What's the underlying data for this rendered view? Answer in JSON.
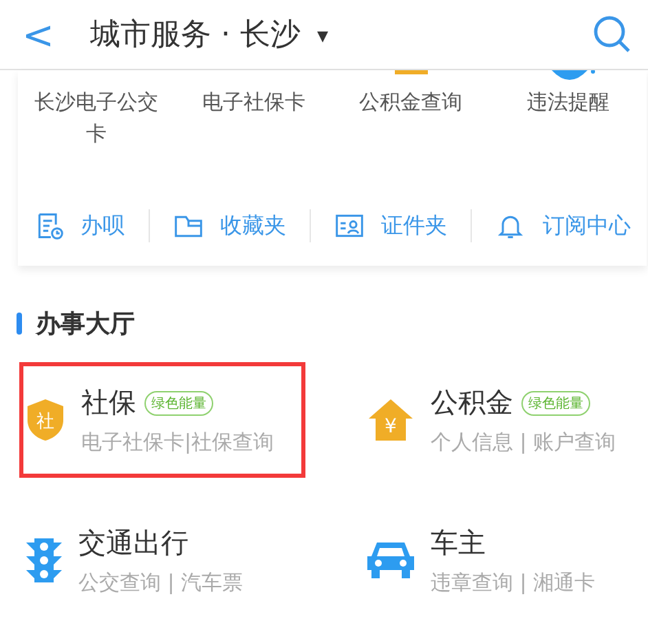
{
  "header": {
    "back": "<",
    "title": "城市服务 · 长沙",
    "dropdown": "▾"
  },
  "shortcuts": [
    {
      "label": "长沙电子公交卡"
    },
    {
      "label": "电子社保卡"
    },
    {
      "label": "公积金查询"
    },
    {
      "label": "违法提醒"
    }
  ],
  "links": [
    {
      "label": "办呗",
      "kind": "doc-clock"
    },
    {
      "label": "收藏夹",
      "kind": "folder"
    },
    {
      "label": "证件夹",
      "kind": "id-card"
    },
    {
      "label": "订阅中心",
      "kind": "bell"
    }
  ],
  "section": {
    "title": "办事大厅"
  },
  "services": [
    {
      "title": "社保",
      "badge": "绿色能量",
      "subtitle": "电子社保卡|社保查询",
      "kind": "shield",
      "icon_text": "社",
      "highlighted": true
    },
    {
      "title": "公积金",
      "badge": "绿色能量",
      "subtitle": "个人信息 | 账户查询",
      "kind": "house",
      "icon_text": "¥",
      "highlighted": false
    },
    {
      "title": "交通出行",
      "subtitle": "公交查询 | 汽车票",
      "kind": "traffic-light",
      "highlighted": false
    },
    {
      "title": "车主",
      "subtitle": "违章查询 | 湘通卡",
      "kind": "car",
      "highlighted": false
    }
  ]
}
